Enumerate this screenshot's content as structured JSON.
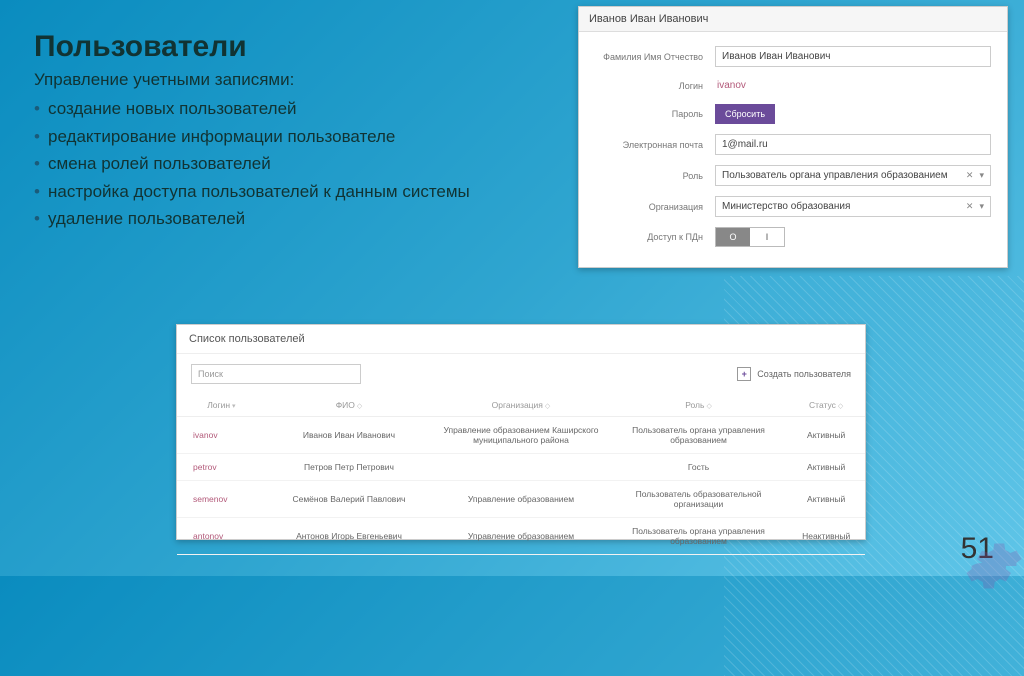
{
  "slide": {
    "title": "Пользователи",
    "subtitle": "Управление учетными записями:",
    "bullets": [
      "создание новых пользователей",
      "редактирование информации пользователе",
      "смена ролей пользователей",
      "настройка доступа пользователей к данным системы",
      "удаление пользователей"
    ],
    "page_number": "51"
  },
  "edit_panel": {
    "header": "Иванов Иван Иванович",
    "labels": {
      "fio": "Фамилия Имя Отчество",
      "login": "Логин",
      "password": "Пароль",
      "email": "Электронная почта",
      "role": "Роль",
      "org": "Организация",
      "pdn": "Доступ к ПДн"
    },
    "values": {
      "fio": "Иванов Иван Иванович",
      "login": "ivanov",
      "email": "1@mail.ru",
      "role": "Пользователь органа управления образованием",
      "org": "Министерство образования"
    },
    "reset_button": "Сбросить",
    "toggle": {
      "on": "O",
      "off": "I"
    }
  },
  "list_panel": {
    "header": "Список пользователей",
    "search_placeholder": "Поиск",
    "create_label": "Создать пользователя",
    "columns": {
      "login": "Логин",
      "fio": "ФИО",
      "org": "Организация",
      "role": "Роль",
      "status": "Статус"
    },
    "rows": [
      {
        "login": "ivanov",
        "fio": "Иванов Иван Иванович",
        "org": "Управление образованием Каширского муниципального района",
        "role": "Пользователь органа управления образованием",
        "status": "Активный"
      },
      {
        "login": "petrov",
        "fio": "Петров Петр Петрович",
        "org": "",
        "role": "Гость",
        "status": "Активный"
      },
      {
        "login": "semenov",
        "fio": "Семёнов Валерий Павлович",
        "org": "Управление образованием",
        "role": "Пользователь образовательной организации",
        "status": "Активный"
      },
      {
        "login": "antonov",
        "fio": "Антонов Игорь Евгеньевич",
        "org": "Управление образованием",
        "role": "Пользователь органа управления образованием",
        "status": "Неактивный"
      }
    ]
  }
}
